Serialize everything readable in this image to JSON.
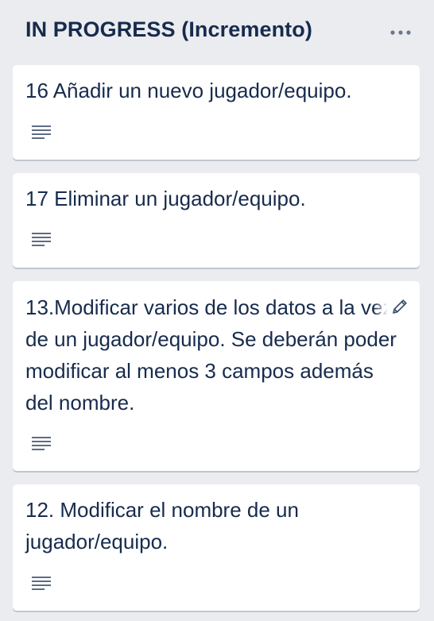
{
  "list": {
    "title": "IN PROGRESS (Incremento)",
    "menu_icon": "more-horizontal-icon"
  },
  "cards": [
    {
      "title": "16 Añadir un nuevo jugador/equipo.",
      "badge_icon": "description-icon"
    },
    {
      "title": "17 Eliminar un jugador/equipo.",
      "badge_icon": "description-icon"
    },
    {
      "title": "13.Modificar varios de los datos a la vez de un jugador/equipo. Se deberán poder modificar al menos 3 campos además del nombre.",
      "badge_icon": "description-icon",
      "edit_icon": "pencil-icon"
    },
    {
      "title": "12. Modificar el nombre de un jugador/equipo.",
      "badge_icon": "description-icon"
    }
  ],
  "colors": {
    "list_background": "#ebecf0",
    "card_background": "#ffffff",
    "text": "#172b4d",
    "icon": "#5e6c84"
  }
}
